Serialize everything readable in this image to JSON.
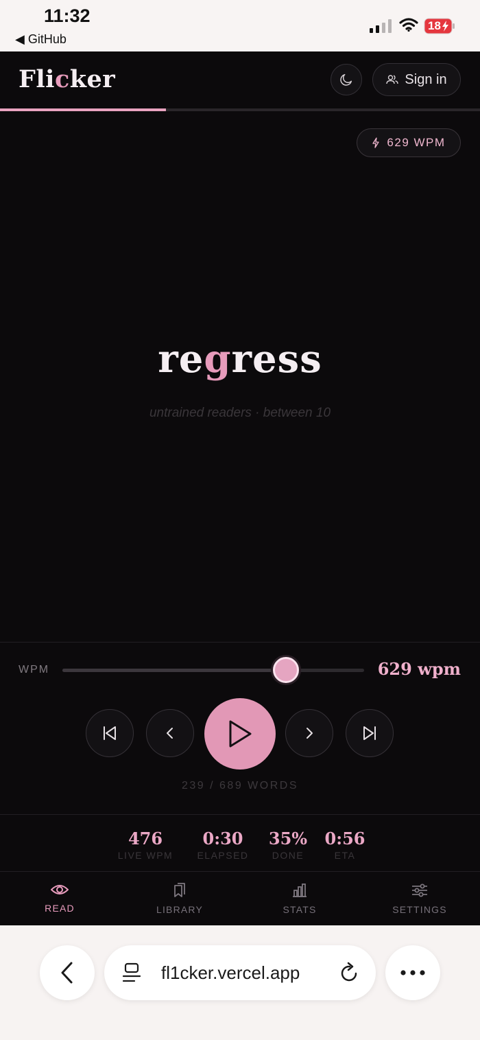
{
  "status_bar": {
    "time": "11:32",
    "back_app": "◀ GitHub",
    "battery": "18",
    "icons": [
      "signal-icon",
      "wifi-icon",
      "battery-charging-icon"
    ]
  },
  "header": {
    "logo_prefix": "Fli",
    "logo_accent": "c",
    "logo_suffix": "ker",
    "theme_icon": "moon-icon",
    "signin_label": "Sign in",
    "signin_icon": "users-icon"
  },
  "reading_progress": 0.345,
  "wpm_badge": {
    "icon": "bolt-icon",
    "label": "629 WPM"
  },
  "reader": {
    "word_pre": "re",
    "word_pivot": "g",
    "word_post": "ress",
    "context": "untrained readers · between 10"
  },
  "controls": {
    "wpm_label": "WPM",
    "wpm_value": "629 wpm",
    "slider_level": 0.74,
    "buttons": [
      "skip-back-icon",
      "previous-icon",
      "play-icon",
      "next-icon",
      "skip-forward-icon"
    ],
    "word_count": "239 / 689 WORDS"
  },
  "stats": [
    {
      "value": "476",
      "label": "LIVE WPM"
    },
    {
      "value": "0:30",
      "label": "ELAPSED"
    },
    {
      "value": "35%",
      "label": "DONE"
    },
    {
      "value": "0:56",
      "label": "ETA"
    }
  ],
  "nav": [
    {
      "label": "READ",
      "icon": "eye-icon",
      "active": true
    },
    {
      "label": "LIBRARY",
      "icon": "bookmarks-icon",
      "active": false
    },
    {
      "label": "STATS",
      "icon": "bar-chart-icon",
      "active": false
    },
    {
      "label": "SETTINGS",
      "icon": "sliders-icon",
      "active": false
    }
  ],
  "browser": {
    "url": "fl1cker.vercel.app"
  },
  "colors": {
    "background": "#0c0a0c",
    "accent": "#e298b6",
    "text": "#f5eef2"
  }
}
